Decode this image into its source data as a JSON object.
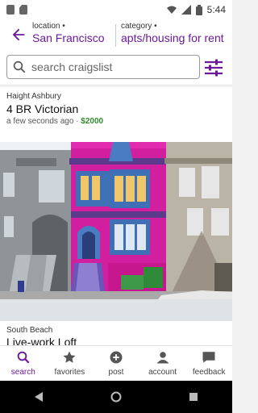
{
  "status": {
    "time": "5:44"
  },
  "header": {
    "location_caption": "location •",
    "location_value": "San Francisco",
    "category_caption": "category •",
    "category_value": "apts/housing for rent"
  },
  "search": {
    "placeholder": "search craigslist"
  },
  "listings": [
    {
      "neighborhood": "Haight Ashbury",
      "title": "4 BR Victorian",
      "age": "a few seconds ago",
      "separator": "·",
      "price": "$2000"
    },
    {
      "neighborhood": "South Beach",
      "title": "Live-work Loft"
    }
  ],
  "tabs": [
    {
      "label": "search",
      "icon": "search-icon"
    },
    {
      "label": "favorites",
      "icon": "star-icon"
    },
    {
      "label": "post",
      "icon": "plus-circle-icon"
    },
    {
      "label": "account",
      "icon": "person-icon"
    },
    {
      "label": "feedback",
      "icon": "chat-icon"
    }
  ],
  "colors": {
    "accent": "#6a1b9a",
    "price": "#2e8b2e"
  }
}
